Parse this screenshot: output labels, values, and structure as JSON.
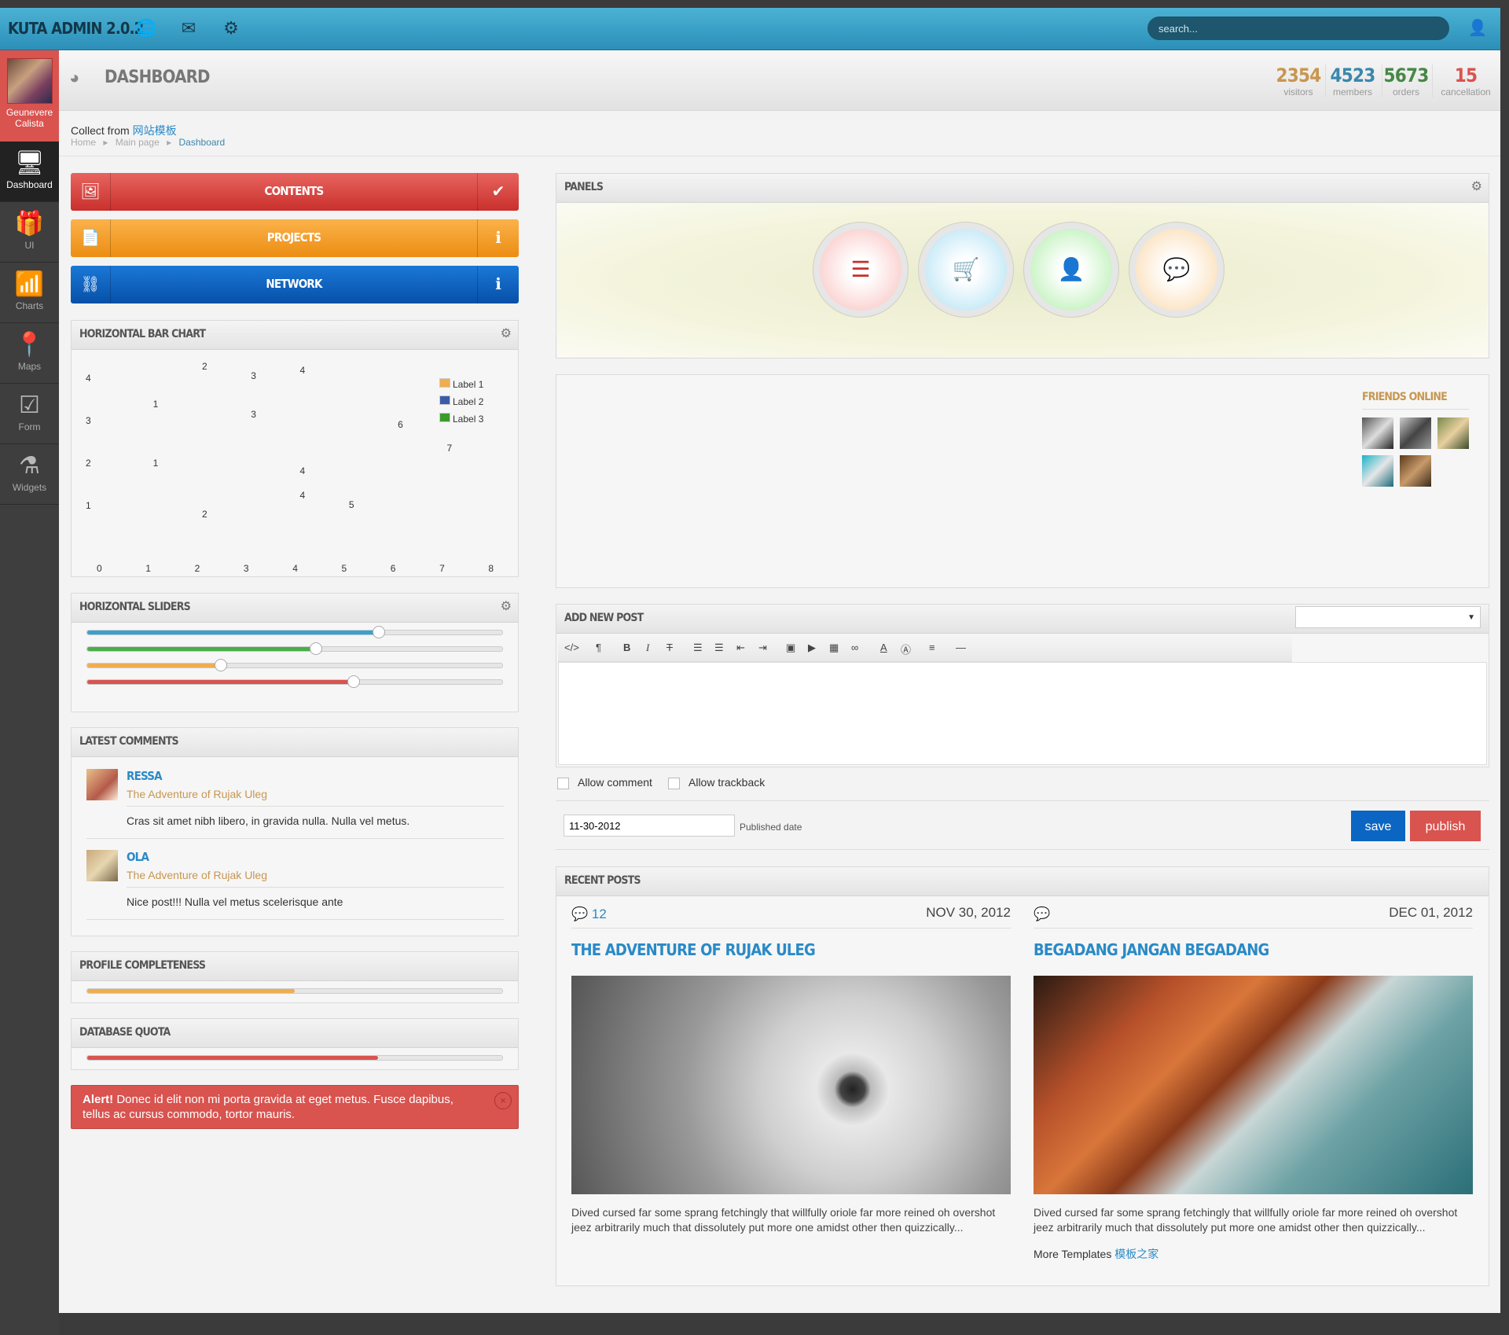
{
  "app": {
    "title": "KUTA ADMIN 2.0.2"
  },
  "search": {
    "placeholder": "search..."
  },
  "user": {
    "name_line1": "Geunevere",
    "name_line2": "Calista"
  },
  "nav": [
    {
      "label": "Dashboard",
      "icon": "monitor-icon"
    },
    {
      "label": "UI",
      "icon": "gift-icon"
    },
    {
      "label": "Charts",
      "icon": "bar-chart-icon"
    },
    {
      "label": "Maps",
      "icon": "map-marker-icon"
    },
    {
      "label": "Form",
      "icon": "check-square-icon"
    },
    {
      "label": "Widgets",
      "icon": "flask-icon"
    }
  ],
  "header": {
    "title": "DASHBOARD"
  },
  "stats": [
    {
      "value": "2354",
      "label": "visitors",
      "color": "#c8964f"
    },
    {
      "value": "4523",
      "label": "members",
      "color": "#3a87ad"
    },
    {
      "value": "5673",
      "label": "orders",
      "color": "#468847"
    },
    {
      "value": "15",
      "label": "cancellation",
      "color": "#d9534f"
    }
  ],
  "collect": {
    "text": "Collect from ",
    "link": "网站模板"
  },
  "breadcrumb": {
    "home": "Home",
    "main": "Main page",
    "current": "Dashboard"
  },
  "bigbuttons": [
    {
      "label": "CONTENTS",
      "color": "#d9534f"
    },
    {
      "label": "PROJECTS",
      "color": "#f0ad4e"
    },
    {
      "label": "NETWORK",
      "color": "#0a66c2"
    }
  ],
  "bar_chart": {
    "title": "HORIZONTAL BAR CHART"
  },
  "chart_data": {
    "type": "scatter",
    "title": "HORIZONTAL BAR CHART",
    "x_ticks": [
      "0",
      "1",
      "2",
      "3",
      "4",
      "5",
      "6",
      "7",
      "8"
    ],
    "y_ticks": [
      "4",
      "3",
      "2",
      "1"
    ],
    "series": [
      {
        "name": "Label 1",
        "color": "#f0ad4e"
      },
      {
        "name": "Label 2",
        "color": "#3a5ba8"
      },
      {
        "name": "Label 3",
        "color": "#3a9a2a"
      }
    ],
    "value_labels": [
      {
        "x": 2.15,
        "y": 4.28,
        "t": "2"
      },
      {
        "x": 3.15,
        "y": 4.05,
        "t": "3"
      },
      {
        "x": 4.15,
        "y": 4.18,
        "t": "4"
      },
      {
        "x": 1.15,
        "y": 3.38,
        "t": "1"
      },
      {
        "x": 3.15,
        "y": 3.15,
        "t": "3"
      },
      {
        "x": 6.15,
        "y": 2.9,
        "t": "6"
      },
      {
        "x": 7.15,
        "y": 2.35,
        "t": "7"
      },
      {
        "x": 1.15,
        "y": 2.0,
        "t": "1"
      },
      {
        "x": 4.15,
        "y": 1.82,
        "t": "4"
      },
      {
        "x": 4.15,
        "y": 1.25,
        "t": "4"
      },
      {
        "x": 5.15,
        "y": 1.02,
        "t": "5"
      },
      {
        "x": 2.15,
        "y": 0.8,
        "t": "2"
      }
    ]
  },
  "sliders": {
    "title": "HORIZONTAL SLIDERS",
    "values": [
      0.7,
      0.55,
      0.32,
      0.64
    ],
    "colors": [
      "#3aa0cf",
      "#4aae4a",
      "#f0ad4e",
      "#d9534f"
    ]
  },
  "comments": {
    "title": "LATEST COMMENTS",
    "items": [
      {
        "name": "RESSA",
        "subtitle": "The Adventure of Rujak Uleg",
        "text": "Cras sit amet nibh libero, in gravida nulla. Nulla vel metus."
      },
      {
        "name": "OLA",
        "subtitle": "The Adventure of Rujak Uleg",
        "text": "Nice post!!! Nulla vel metus scelerisque ante"
      }
    ]
  },
  "profile": {
    "title": "PROFILE COMPLETENESS",
    "value": 0.5,
    "color": "#f0ad4e"
  },
  "quota": {
    "title": "DATABASE QUOTA",
    "value": 0.7,
    "color": "#d9534f"
  },
  "alert": {
    "strong": "Alert!",
    "text": " Donec id elit non mi porta gravida at eget metus. Fusce dapibus, tellus ac cursus commodo, tortor mauris."
  },
  "panels": {
    "title": "PANELS"
  },
  "friends": {
    "title": "FRIENDS ONLINE"
  },
  "new_post": {
    "title": "ADD NEW POST",
    "allow_comment": "Allow comment",
    "allow_trackback": "Allow trackback",
    "date": "11-30-2012",
    "date_label": "Published date",
    "save": "save",
    "publish": "publish"
  },
  "recent": {
    "title": "RECENT POSTS",
    "posts": [
      {
        "comments": "12",
        "date": "NOV 30, 2012",
        "title": "THE ADVENTURE OF RUJAK ULEG",
        "excerpt": "Dived cursed far some sprang fetchingly that willfully oriole far more reined oh overshot jeez arbitrarily much that dissolutely put more one amidst other then quizzically..."
      },
      {
        "comments": "",
        "date": "DEC 01, 2012",
        "title": "BEGADANG JANGAN BEGADANG",
        "excerpt": "Dived cursed far some sprang fetchingly that willfully oriole far more reined oh overshot jeez arbitrarily much that dissolutely put more one amidst other then quizzically..."
      }
    ],
    "more_text": "More Templates ",
    "more_link": "模板之家"
  }
}
